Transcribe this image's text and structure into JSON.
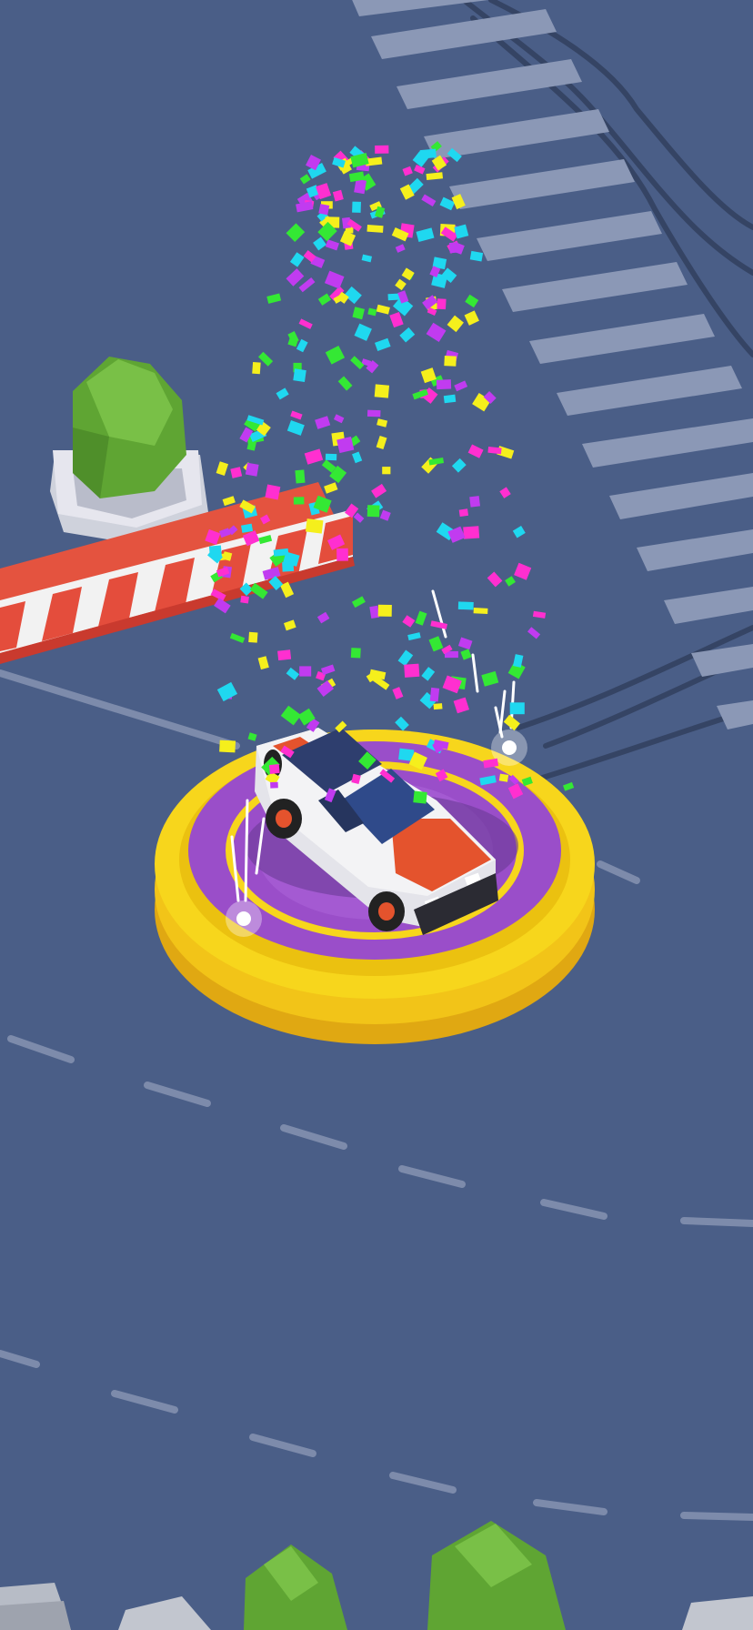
{
  "scene": {
    "type": "game-screen",
    "description_label": "car-celebration-podium",
    "has_text_overlay": false,
    "colors": {
      "road": "#4a5e87",
      "road_dark_edge": "#3f5279",
      "crosswalk": "#8b98b6",
      "lane_marking": "#7d8bab",
      "tire_track": "#2f3c59",
      "podium_gold": "#f7d61c",
      "podium_gold_shadow": "#e8b90f",
      "podium_purple": "#9a4ec9",
      "barrier_red": "#e44d3c",
      "barrier_white": "#f2f2f2",
      "bush_green": "#6db53c",
      "planter_white": "#e6e6ee",
      "car_body": "#eeeeee",
      "car_stripe": "#e4532d",
      "car_window": "#2e3e6e",
      "rock_gray": "#b7bcc6"
    },
    "confetti_colors": [
      "#ff2fd0",
      "#1fd8f0",
      "#f5ef1c",
      "#34e834",
      "#c13bf0"
    ],
    "elements": {
      "car": "white-and-orange-race-car",
      "podium": "gold-purple-winner-podium",
      "barrier": "red-white-striped-barrier",
      "planter": "planter-with-bush",
      "crosswalk": "zebra-crosswalk",
      "bottom_decor": "bushes-and-rocks"
    }
  }
}
